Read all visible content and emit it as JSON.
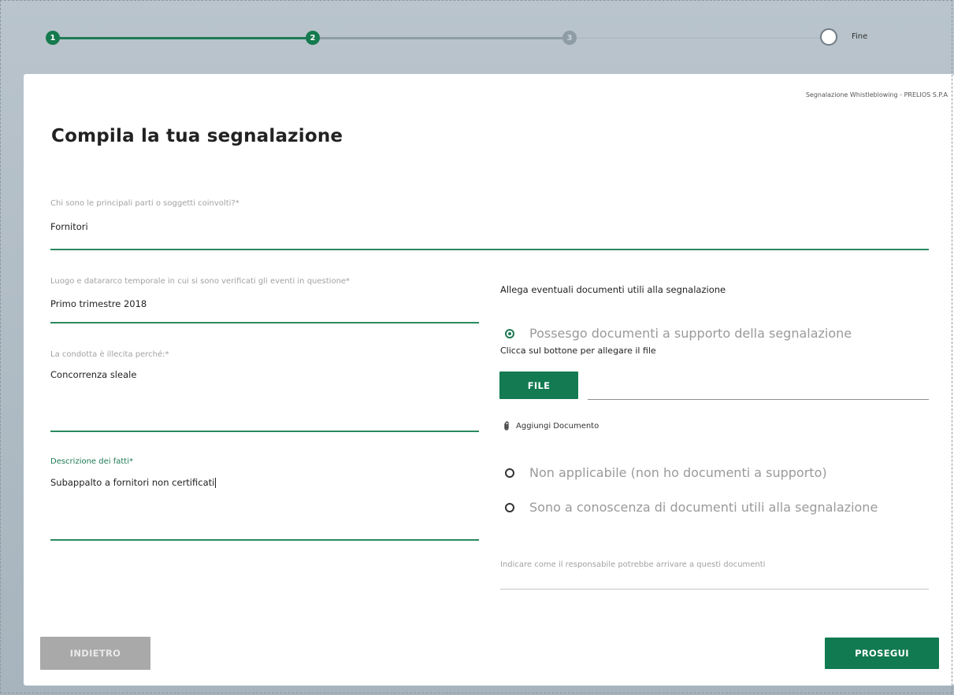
{
  "stepper": {
    "steps": [
      {
        "label": "1",
        "state": "done"
      },
      {
        "label": "2",
        "state": "current"
      },
      {
        "label": "3",
        "state": "pending"
      }
    ],
    "final_label": "Fine",
    "colors": {
      "done": "#157a4e",
      "pending": "#8e9ca6"
    }
  },
  "card": {
    "meta": "Segnalazione Whistleblowing - PRELIOS S.P.A",
    "title": "Compila la tua segnalazione"
  },
  "form": {
    "parties": {
      "label": "Chi sono le principali parti o soggetti coinvolti?*",
      "value": "Fornitori"
    },
    "place_time": {
      "label": "Luogo e datararco temporale in cui si sono verificati gli eventi in questione*",
      "value": "Primo trimestre 2018"
    },
    "conduct": {
      "label": "La condotta è illecita perché:*",
      "value": "Concorrenza sleale"
    },
    "description": {
      "label": "Descrizione dei fatti*",
      "value": "Subappalto a fornitori non certificati"
    }
  },
  "attachments": {
    "heading": "Allega eventuali documenti utili alla segnalazione",
    "options": [
      {
        "label": "Possesgo documenti a supporto della segnalazione",
        "selected": true
      },
      {
        "label": "Non applicabile (non ho documenti a supporto)",
        "selected": false
      },
      {
        "label": "Sono a conoscenza di documenti utili alla segnalazione",
        "selected": false
      }
    ],
    "upload_hint": "Clicca sul bottone per allegare il file",
    "file_button": "FILE",
    "add_document": "Aggiungi Documento",
    "responsible_placeholder": "Indicare come il responsabile potrebbe arrivare a questi documenti"
  },
  "actions": {
    "back": "INDIETRO",
    "next": "PROSEGUI"
  },
  "colors": {
    "accent": "#137a52",
    "disabled": "#a9a9a9"
  }
}
